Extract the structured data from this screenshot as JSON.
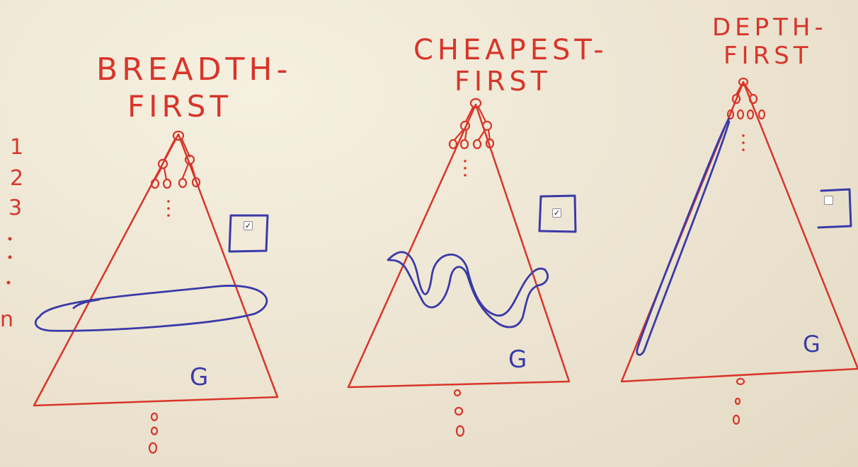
{
  "titles": {
    "breadth": [
      "BREADTH-",
      "FIRST"
    ],
    "cheapest": [
      "CHEAPEST-",
      "FIRST"
    ],
    "depth": [
      "DEPTH-",
      "FIRST"
    ]
  },
  "level_labels": [
    "1",
    "2",
    "3",
    "n"
  ],
  "goal_label": "G",
  "checkboxes": [
    {
      "name": "breadth-first",
      "checked": true
    },
    {
      "name": "cheapest-first",
      "checked": true
    },
    {
      "name": "depth-first",
      "checked": false
    }
  ],
  "colors": {
    "marker_red": "#d8352a",
    "marker_blue": "#3a3aa8"
  }
}
